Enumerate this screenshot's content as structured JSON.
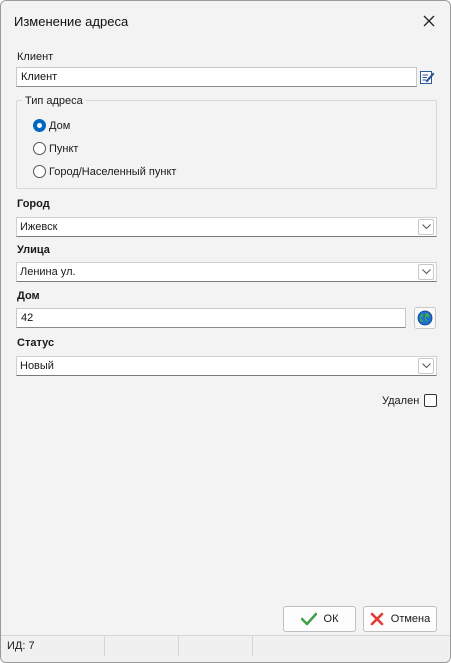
{
  "window": {
    "title": "Изменение адреса"
  },
  "client": {
    "label": "Клиент",
    "value": "Клиент"
  },
  "address_type": {
    "label": "Тип адреса",
    "options": [
      {
        "label": "Дом",
        "checked": true
      },
      {
        "label": "Пункт",
        "checked": false
      },
      {
        "label": "Город/Населенный пункт",
        "checked": false
      }
    ]
  },
  "city": {
    "label": "Город",
    "value": "Ижевск"
  },
  "street": {
    "label": "Улица",
    "value": "Ленина ул."
  },
  "house": {
    "label": "Дом",
    "value": "42"
  },
  "status": {
    "label": "Статус",
    "value": "Новый"
  },
  "deleted": {
    "label": "Удален",
    "checked": false
  },
  "buttons": {
    "ok": "ОК",
    "cancel": "Отмена"
  },
  "statusbar": {
    "id_text": "ИД: 7"
  },
  "colors": {
    "accent": "#0067c0",
    "ok_green": "#43a047",
    "cancel_red": "#e53935"
  }
}
